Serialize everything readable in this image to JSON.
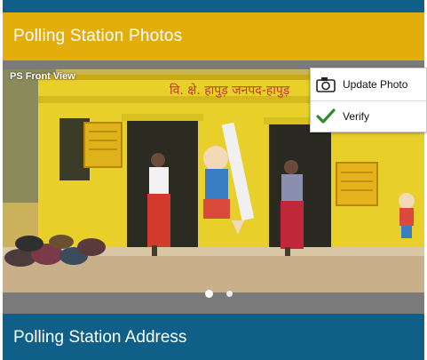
{
  "header": {
    "title": "Polling Station Photos"
  },
  "photo": {
    "caption": "PS Front View",
    "wall_text": "वि. क्षे. हापुड़ जनपद-हापुड़",
    "image_count": 2,
    "active_index": 1
  },
  "menu": {
    "items": [
      {
        "label": "Update Photo",
        "icon": "camera-icon"
      },
      {
        "label": "Verify",
        "icon": "check-icon",
        "icon_color": "#2e8b2e"
      }
    ]
  },
  "footer": {
    "title": "Polling Station Address"
  },
  "colors": {
    "header": "#e3ad0b",
    "primary": "#0f5f88",
    "band": "#7b7b7b",
    "wall": "#e8cf2a"
  }
}
